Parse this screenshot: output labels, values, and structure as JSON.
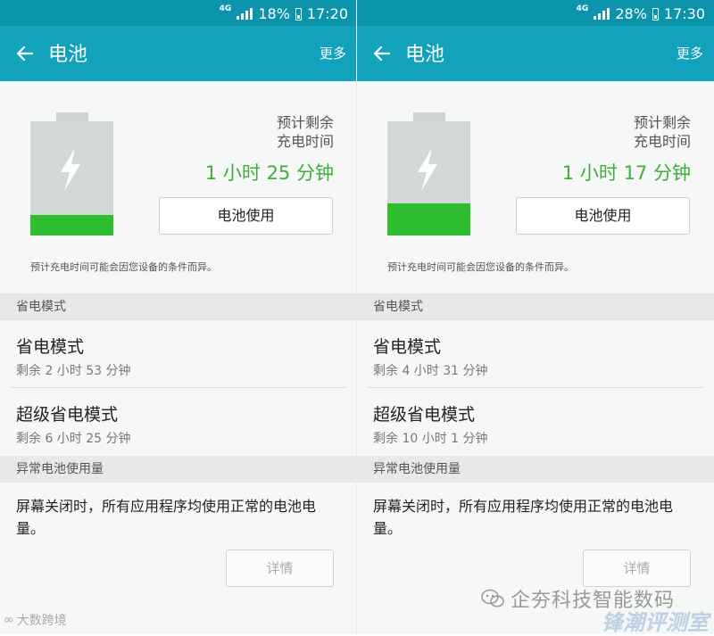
{
  "screens": [
    {
      "status": {
        "network": "4G",
        "battery_percent": "18%",
        "time": "17:20"
      },
      "appbar": {
        "title": "电池",
        "more": "更多"
      },
      "summary": {
        "estimate_label_line1": "预计剩余",
        "estimate_label_line2": "充电时间",
        "estimate_time": "1 小时 25 分钟",
        "battery_level": 0.18,
        "usage_button": "电池使用",
        "note": "预计充电时间可能会因您设备的条件而异。"
      },
      "power_saving": {
        "header": "省电模式",
        "items": [
          {
            "title": "省电模式",
            "subtitle": "剩余 2 小时 53 分钟"
          },
          {
            "title": "超级省电模式",
            "subtitle": "剩余 6 小时 25 分钟"
          }
        ]
      },
      "abnormal": {
        "header": "异常电池使用量",
        "text": "屏幕关闭时，所有应用程序均使用正常的电池电量。",
        "details_button": "详情"
      }
    },
    {
      "status": {
        "network": "4G",
        "battery_percent": "28%",
        "time": "17:30"
      },
      "appbar": {
        "title": "电池",
        "more": "更多"
      },
      "summary": {
        "estimate_label_line1": "预计剩余",
        "estimate_label_line2": "充电时间",
        "estimate_time": "1 小时 17 分钟",
        "battery_level": 0.28,
        "usage_button": "电池使用",
        "note": "预计充电时间可能会因您设备的条件而异。"
      },
      "power_saving": {
        "header": "省电模式",
        "items": [
          {
            "title": "省电模式",
            "subtitle": "剩余 4 小时 31 分钟"
          },
          {
            "title": "超级省电模式",
            "subtitle": "剩余 10 小时 1 分钟"
          }
        ]
      },
      "abnormal": {
        "header": "异常电池使用量",
        "text": "屏幕关闭时，所有应用程序均使用正常的电池电量。",
        "details_button": "详情"
      }
    }
  ],
  "watermarks": {
    "left": "大数跨境",
    "right": "企夯科技智能数码",
    "logo": "锋潮评测室"
  },
  "colors": {
    "statusbar": "#0c94ad",
    "appbar": "#13a2bb",
    "accent_green": "#3fae3a",
    "battery_fill": "#2fbe2f"
  }
}
